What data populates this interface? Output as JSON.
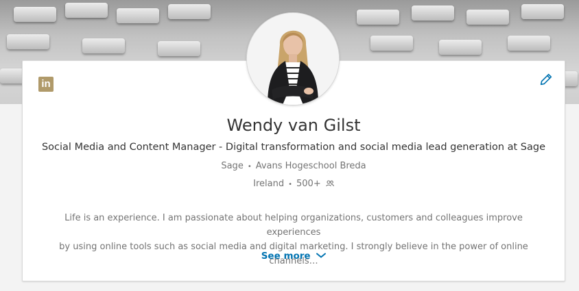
{
  "profile": {
    "name": "Wendy van Gilst",
    "headline": "Social Media and Content Manager - Digital transformation and social media lead generation at Sage",
    "company": "Sage",
    "school": "Avans Hogeschool Breda",
    "location": "Ireland",
    "connections": "500+",
    "separator": "•",
    "summary_line1": "Life is an experience. I am passionate about helping organizations, customers and colleagues improve experiences",
    "summary_line2": "by using online tools such as social media and digital marketing. I strongly believe in the power of online channels…",
    "see_more_label": "See more"
  },
  "brand": {
    "logo_text": "in",
    "logo_color": "#b09a6a",
    "link_color": "#0073b1"
  },
  "icons": {
    "logo": "linkedin-logo-icon",
    "edit": "pencil-icon",
    "connections": "people-icon",
    "expand": "chevron-down-icon"
  }
}
